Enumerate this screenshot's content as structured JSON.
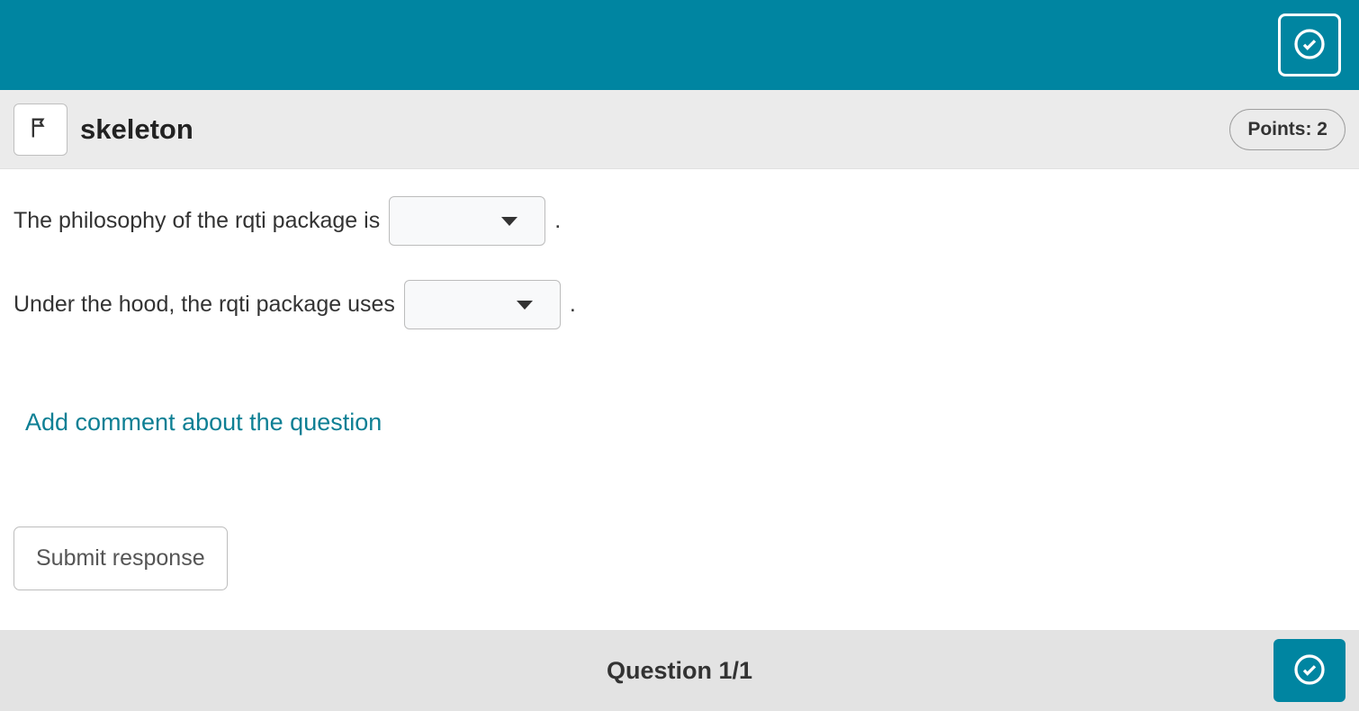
{
  "top_bar": {},
  "header": {
    "title": "skeleton",
    "points_label": "Points: 2"
  },
  "content": {
    "sentence1_before": "The philosophy of the rqti package is",
    "sentence1_after": ".",
    "sentence2_before": "Under the hood, the rqti package uses",
    "sentence2_after": ".",
    "add_comment_label": "Add comment about the question",
    "submit_label": "Submit response"
  },
  "footer": {
    "progress_label": "Question 1/1"
  }
}
